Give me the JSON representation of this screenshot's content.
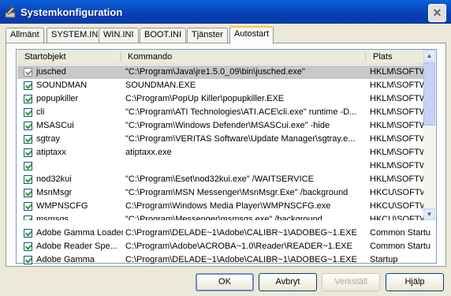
{
  "window": {
    "title": "Systemkonfiguration",
    "close_glyph": "✕"
  },
  "tabs": [
    {
      "label": "Allmänt"
    },
    {
      "label": "SYSTEM.INI"
    },
    {
      "label": "WIN.INI"
    },
    {
      "label": "BOOT.INI"
    },
    {
      "label": "Tjänster"
    },
    {
      "label": "Autostart"
    }
  ],
  "table": {
    "columns": [
      "Startobjekt",
      "Kommando",
      "Plats"
    ],
    "rows": [
      {
        "name": "jusched",
        "command": "\"C:\\Program\\Java\\jre1.5.0_09\\bin\\jusched.exe\"",
        "location": "HKLM\\SOFTWA",
        "checked": true,
        "selected": true
      },
      {
        "name": "SOUNDMAN",
        "command": "SOUNDMAN.EXE",
        "location": "HKLM\\SOFTWA",
        "checked": true
      },
      {
        "name": "popupkiller",
        "command": "C:\\Program\\PopUp Killer\\popupkiller.EXE",
        "location": "HKLM\\SOFTWA",
        "checked": true
      },
      {
        "name": "cli",
        "command": "\"C:\\Program\\ATI Technologies\\ATI.ACE\\cli.exe\" runtime -D...",
        "location": "HKLM\\SOFTWA",
        "checked": true
      },
      {
        "name": "MSASCui",
        "command": "\"C:\\Program\\Windows Defender\\MSASCui.exe\" -hide",
        "location": "HKLM\\SOFTWA",
        "checked": true
      },
      {
        "name": "sgtray",
        "command": "\"C:\\Program\\VERITAS Software\\Update Manager\\sgtray.e...",
        "location": "HKLM\\SOFTWA",
        "checked": true
      },
      {
        "name": "atiptaxx",
        "command": "atiptaxx.exe",
        "location": "HKLM\\SOFTWA",
        "checked": true
      },
      {
        "name": "",
        "command": "",
        "location": "HKLM\\SOFTWA",
        "checked": true
      },
      {
        "name": "nod32kui",
        "command": "\"C:\\Program\\Eset\\nod32kui.exe\" /WAITSERVICE",
        "location": "HKLM\\SOFTWA",
        "checked": true
      },
      {
        "name": "MsnMsgr",
        "command": "\"C:\\Program\\MSN Messenger\\MsnMsgr.Exe\" /background",
        "location": "HKCU\\SOFTWA",
        "checked": true
      },
      {
        "name": "WMPNSCFG",
        "command": "C:\\Program\\Windows Media Player\\WMPNSCFG.exe",
        "location": "HKCU\\SOFTWA",
        "checked": true
      },
      {
        "name": "msmsgs",
        "command": "\"C:\\Program\\Messenger\\msmsgs.exe\" /background",
        "location": "HKCU\\SOFTWA",
        "checked": true
      }
    ],
    "overflow_rows": [
      {
        "name": "Adobe Gamma Loader",
        "command": "C:\\Program\\DELADE~1\\Adobe\\CALIBR~1\\ADOBEG~1.EXE",
        "location": "Common Startu",
        "checked": true
      },
      {
        "name": "Adobe Reader Spe...",
        "command": "C:\\Program\\Adobe\\ACROBA~1.0\\Reader\\READER~1.EXE",
        "location": "Common Startu",
        "checked": true
      },
      {
        "name": "Adobe Gamma",
        "command": "C:\\Program\\DELADE~1\\Adobe\\CALIBR~1\\ADOBEG~1.EXE",
        "location": "Startup",
        "checked": true
      }
    ]
  },
  "scrollbar": {
    "up_glyph": "▲",
    "down_glyph": "▼"
  },
  "buttons": {
    "ok": "OK",
    "cancel": "Avbryt",
    "apply": "Verkställ",
    "help": "Hjälp"
  }
}
